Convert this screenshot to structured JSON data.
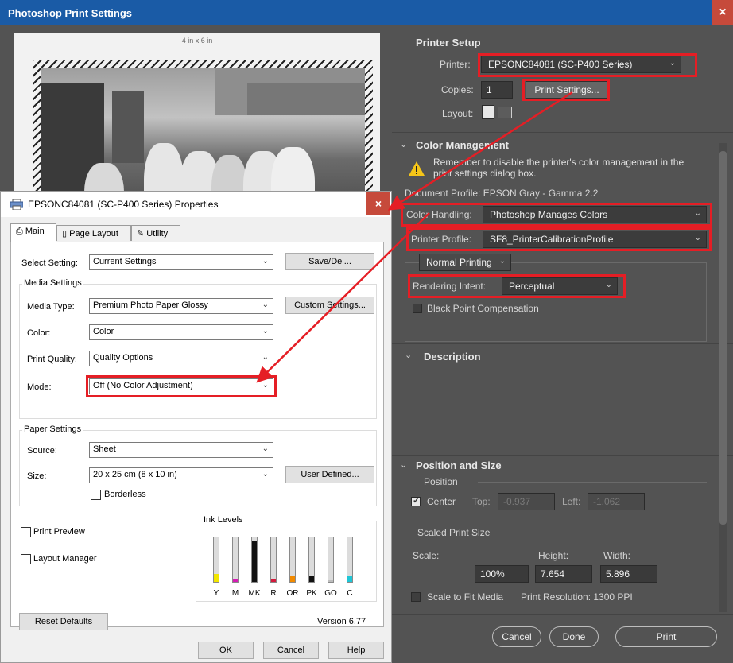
{
  "photoshop": {
    "title": "Photoshop Print Settings",
    "preview_size_label": "4 in x 6 in",
    "printer_setup": {
      "title": "Printer Setup",
      "printer_label": "Printer:",
      "printer_value": "EPSONC84081 (SC-P400 Series)",
      "copies_label": "Copies:",
      "copies_value": "1",
      "print_settings_label": "Print Settings...",
      "layout_label": "Layout:"
    },
    "color_management": {
      "title": "Color Management",
      "warning_text": "Remember to disable the printer's color management in the print settings dialog box.",
      "document_profile": "Document Profile: EPSON  Gray - Gamma 2.2",
      "color_handling_label": "Color Handling:",
      "color_handling_value": "Photoshop Manages Colors",
      "printer_profile_label": "Printer Profile:",
      "printer_profile_value": "SF8_PrinterCalibrationProfile",
      "normal_printing_value": "Normal Printing",
      "rendering_intent_label": "Rendering Intent:",
      "rendering_intent_value": "Perceptual",
      "black_point_label": "Black Point Compensation"
    },
    "description": {
      "title": "Description"
    },
    "position_size": {
      "title": "Position and Size",
      "position_label": "Position",
      "center_label": "Center",
      "top_label": "Top:",
      "top_value": "-0.937",
      "left_label": "Left:",
      "left_value": "-1.062",
      "scaled_label": "Scaled Print Size",
      "scale_label": "Scale:",
      "height_label": "Height:",
      "width_label": "Width:",
      "scale_value": "100%",
      "height_value": "7.654",
      "width_value": "5.896",
      "fit_label": "Scale to Fit Media",
      "resolution_label": "Print Resolution: 1300 PPI"
    },
    "buttons": {
      "cancel": "Cancel",
      "done": "Done",
      "print": "Print"
    },
    "highlight_color": "#e51e25"
  },
  "epson": {
    "title": "EPSONC84081 (SC-P400 Series) Properties",
    "tabs": [
      "Main",
      "Page Layout",
      "Utility"
    ],
    "select_setting_label": "Select Setting:",
    "select_setting_value": "Current Settings",
    "save_del_label": "Save/Del...",
    "media_settings_label": "Media Settings",
    "media_type_label": "Media Type:",
    "media_type_value": "Premium Photo Paper Glossy",
    "custom_settings_label": "Custom Settings...",
    "color_label": "Color:",
    "color_value": "Color",
    "print_quality_label": "Print Quality:",
    "print_quality_value": "Quality Options",
    "mode_label": "Mode:",
    "mode_value": "Off (No Color Adjustment)",
    "paper_settings_label": "Paper Settings",
    "source_label": "Source:",
    "source_value": "Sheet",
    "size_label": "Size:",
    "size_value": "20 x 25 cm (8 x 10 in)",
    "user_defined_label": "User Defined...",
    "borderless_label": "Borderless",
    "print_preview_label": "Print Preview",
    "layout_manager_label": "Layout Manager",
    "ink_levels_label": "Ink Levels",
    "inks": [
      {
        "name": "Y",
        "level": 0.18,
        "color": "#f2e600"
      },
      {
        "name": "M",
        "level": 0.08,
        "color": "#d61cb4"
      },
      {
        "name": "MK",
        "level": 0.92,
        "color": "#111111"
      },
      {
        "name": "R",
        "level": 0.08,
        "color": "#d41a3c"
      },
      {
        "name": "OR",
        "level": 0.14,
        "color": "#f28a00"
      },
      {
        "name": "PK",
        "level": 0.14,
        "color": "#111111"
      },
      {
        "name": "GO",
        "level": 0.05,
        "color": "#bdbdbd"
      },
      {
        "name": "C",
        "level": 0.14,
        "color": "#1fc6d6"
      }
    ],
    "reset_defaults_label": "Reset Defaults",
    "version_label": "Version 6.77",
    "ok_label": "OK",
    "cancel_label": "Cancel",
    "help_label": "Help"
  }
}
